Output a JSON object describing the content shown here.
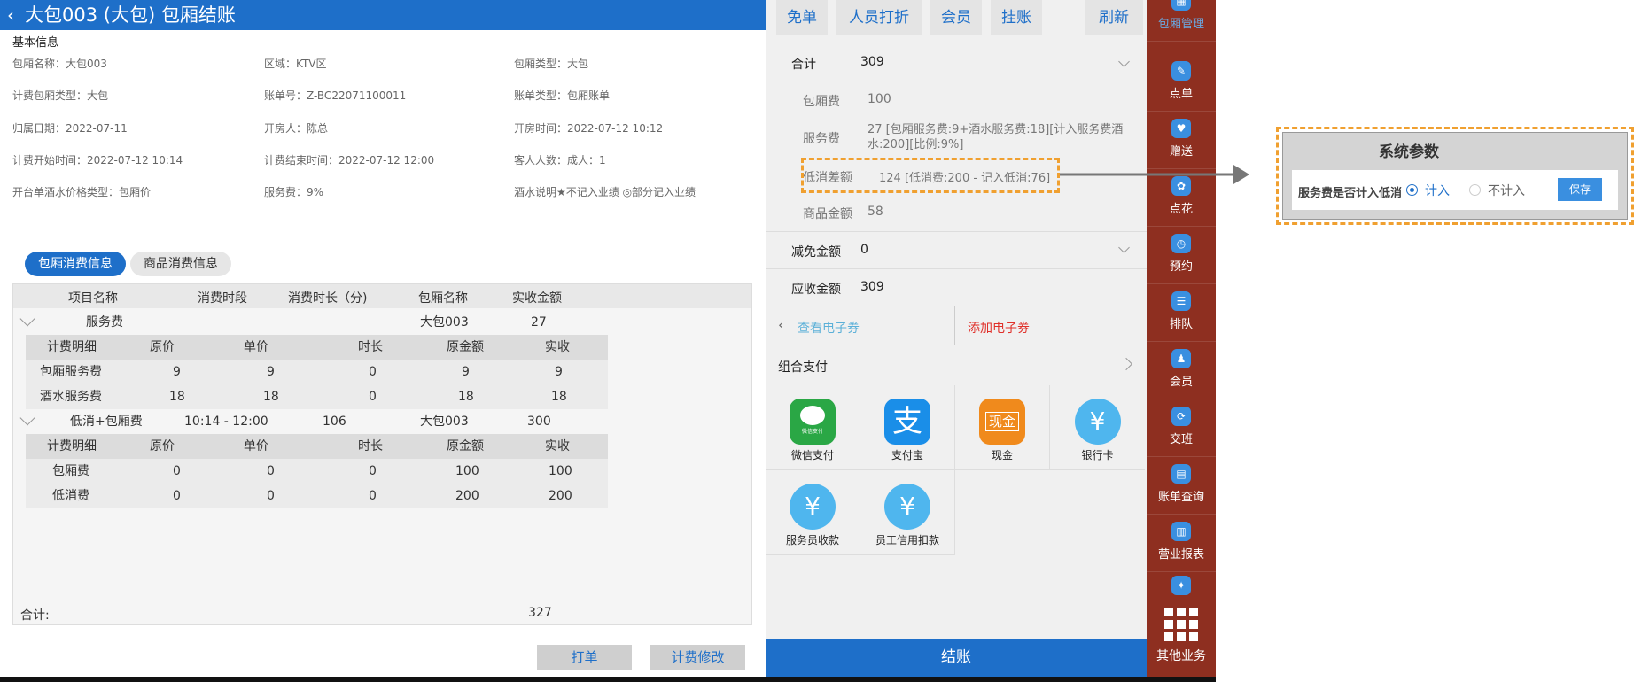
{
  "header": {
    "back_icon": "chevron-left-icon",
    "title": "大包003 (大包) 包厢结账"
  },
  "basic_info": {
    "title": "基本信息",
    "rows": [
      [
        "包厢名称：大包003",
        "区域：KTV区",
        "包厢类型：大包"
      ],
      [
        "计费包厢类型：大包",
        "账单号：Z-BC22071100011",
        "账单类型：包厢账单"
      ],
      [
        "归属日期：2022-07-11",
        "开房人：陈总",
        "开房时间：2022-07-12 10:12"
      ],
      [
        "计费开始时间：2022-07-12 10:14",
        "计费结束时间：2022-07-12 12:00",
        "客人人数：成人：1"
      ],
      [
        "开台单酒水价格类型：包厢价",
        "服务费：9%",
        "酒水说明★不记入业绩 ◎部分记入业绩"
      ]
    ]
  },
  "tabs": [
    {
      "label": "包厢消费信息",
      "active": true
    },
    {
      "label": "商品消费信息",
      "active": false
    }
  ],
  "table": {
    "headers": [
      "项目名称",
      "消费时段",
      "消费时长（分)",
      "包厢名称",
      "实收金额"
    ],
    "groups": [
      {
        "row": [
          "服务费",
          "",
          "",
          "大包003",
          "27"
        ],
        "sub_headers": [
          "计费明细",
          "原价",
          "单价",
          "时长",
          "原金额",
          "实收"
        ],
        "sub_rows": [
          [
            "包厢服务费",
            "9",
            "9",
            "0",
            "9",
            "9"
          ],
          [
            "酒水服务费",
            "18",
            "18",
            "0",
            "18",
            "18"
          ]
        ]
      },
      {
        "row": [
          "低消+包厢费",
          "10:14 - 12:00",
          "106",
          "大包003",
          "300"
        ],
        "sub_headers": [
          "计费明细",
          "原价",
          "单价",
          "时长",
          "原金额",
          "实收"
        ],
        "sub_rows": [
          [
            "包厢费",
            "0",
            "0",
            "0",
            "100",
            "100"
          ],
          [
            "低消费",
            "0",
            "0",
            "0",
            "200",
            "200"
          ]
        ]
      }
    ],
    "total_label": "合计:",
    "total_value": "327"
  },
  "bottom_buttons": {
    "print": "打单",
    "modify": "计费修改"
  },
  "top_actions": [
    "免单",
    "人员打折",
    "会员",
    "挂账",
    "刷新"
  ],
  "summary": {
    "total": {
      "label": "合计",
      "value": "309"
    },
    "items": [
      {
        "label": "包厢费",
        "value": "100"
      },
      {
        "label": "服务费",
        "value": "27 [包厢服务费:9+酒水服务费:18][计入服务费酒水:200][比例:9%]"
      },
      {
        "label": "低消差额",
        "value": "124 [低消费:200 - 记入低消:76]"
      },
      {
        "label": "商品金额",
        "value": "58"
      }
    ],
    "discount": {
      "label": "减免金额",
      "value": "0"
    },
    "receivable": {
      "label": "应收金额",
      "value": "309"
    }
  },
  "coupons": {
    "view": "查看电子券",
    "add": "添加电子券"
  },
  "combo_pay": "组合支付",
  "payments": [
    {
      "label": "微信支付",
      "icon": "wechat-pay-icon",
      "color": "#2aa745"
    },
    {
      "label": "支付宝",
      "icon": "alipay-icon",
      "color": "#1a8ee8"
    },
    {
      "label": "现金",
      "icon": "cash-icon",
      "color": "#f08a1c"
    },
    {
      "label": "银行卡",
      "icon": "bank-card-icon",
      "color": "#4fb6ee"
    },
    {
      "label": "服务员收款",
      "icon": "waiter-collect-icon",
      "color": "#4fb6ee"
    },
    {
      "label": "员工信用扣款",
      "icon": "staff-credit-icon",
      "color": "#4fb6ee"
    }
  ],
  "pay_icon_texts": {
    "cash": "现金",
    "wechat_badge": "微信支付",
    "yen": "¥",
    "alipay": "支"
  },
  "checkout": "结账",
  "sidebar": [
    {
      "label": "包厢管理",
      "icon": "grid-icon"
    },
    {
      "label": "点单",
      "icon": "order-icon"
    },
    {
      "label": "赠送",
      "icon": "gift-icon"
    },
    {
      "label": "点花",
      "icon": "flower-icon"
    },
    {
      "label": "预约",
      "icon": "reserve-icon"
    },
    {
      "label": "排队",
      "icon": "queue-icon"
    },
    {
      "label": "会员",
      "icon": "member-icon"
    },
    {
      "label": "交班",
      "icon": "shift-icon"
    },
    {
      "label": "账单查询",
      "icon": "bill-query-icon"
    },
    {
      "label": "营业报表",
      "icon": "report-icon"
    },
    {
      "label": "",
      "icon": "more-app-icon"
    }
  ],
  "other_business": "其他业务",
  "system_params": {
    "title": "系统参数",
    "label": "服务费是否计入低消",
    "option_yes": "计入",
    "option_no": "不计入",
    "save": "保存",
    "selected": "计入"
  },
  "colors": {
    "primary": "#1e6fc9",
    "sidebar": "#8e2f20",
    "highlight": "#f0a030"
  }
}
